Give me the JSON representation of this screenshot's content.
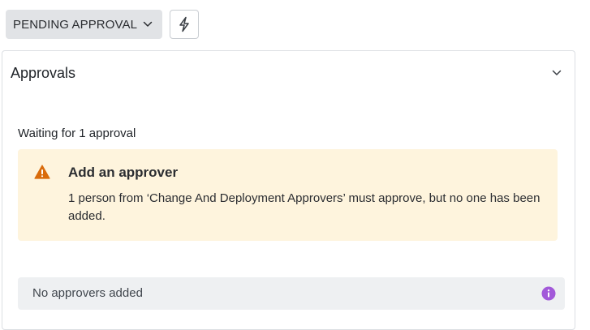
{
  "status": {
    "label": "PENDING APPROVAL",
    "icon": "chevron-down-icon"
  },
  "action_button": {
    "icon": "lightning-bolt-icon"
  },
  "panel": {
    "title": "Approvals",
    "toggle_icon": "chevron-down-icon",
    "waiting_label": "Waiting for 1 approval",
    "warning": {
      "icon": "warning-triangle-icon",
      "title": "Add an approver",
      "message": "1 person from ‘Change And Deployment Approvers’ must approve, but no one has been added."
    },
    "approvers": {
      "empty_text": "No approvers added",
      "icon": "info-icon"
    }
  },
  "colors": {
    "warning_background": "#fef4dd",
    "warning_icon": "#d96b0b",
    "info_icon": "#a259d9",
    "status_background": "#e1e3e6",
    "approvers_background": "#eef0f2"
  }
}
